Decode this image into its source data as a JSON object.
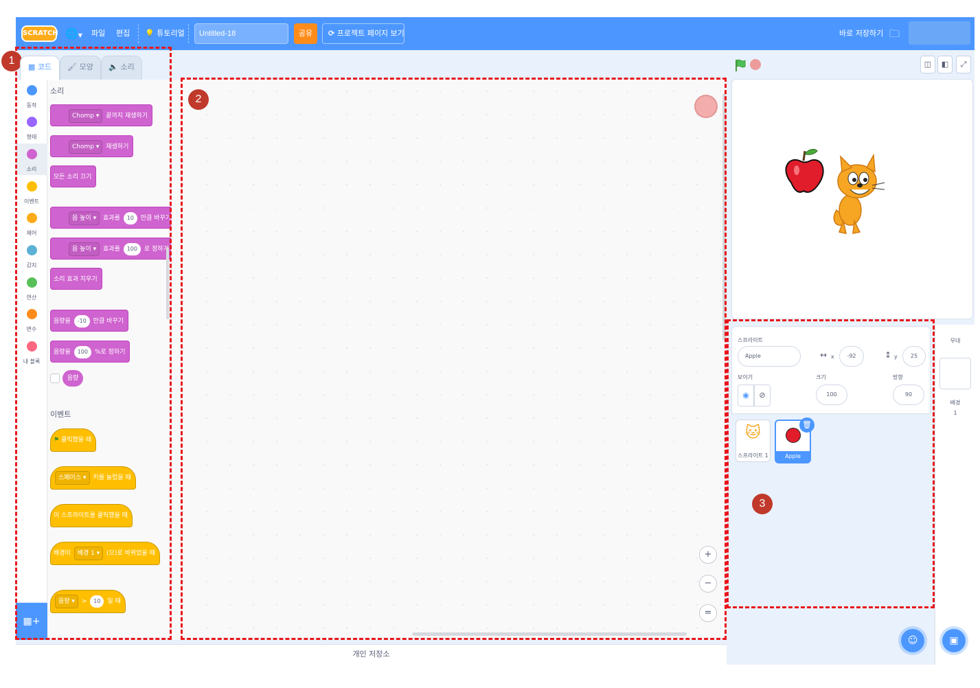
{
  "menubar": {
    "logo": "SCRATCH",
    "file": "파일",
    "edit": "편집",
    "tutorial": "튜토리얼",
    "project_title": "Untitled-18",
    "share": "공유",
    "see_project_page": "프로젝트 페이지 보기",
    "save_now": "바로 저장하기"
  },
  "tabs": {
    "code": "코드",
    "costumes": "모양",
    "sounds": "소리"
  },
  "categories": [
    {
      "label": "동작",
      "color": "#4c97ff"
    },
    {
      "label": "형태",
      "color": "#9966ff"
    },
    {
      "label": "소리",
      "color": "#cf63cf"
    },
    {
      "label": "이벤트",
      "color": "#ffbf00"
    },
    {
      "label": "제어",
      "color": "#ffab19"
    },
    {
      "label": "감지",
      "color": "#5cb1d6"
    },
    {
      "label": "연산",
      "color": "#59c059"
    },
    {
      "label": "변수",
      "color": "#ff8c1a"
    },
    {
      "label": "내 블록",
      "color": "#ff6680"
    }
  ],
  "palette": {
    "sound_heading": "소리",
    "play_until_done": {
      "sound": "Chomp",
      "text": "끝까지 재생하기"
    },
    "start_sound": {
      "sound": "Chomp",
      "text": "재생하기"
    },
    "stop_all_sounds": "모든 소리 끄기",
    "change_effect": {
      "effect": "음 높이",
      "pre": "효과를",
      "value": "10",
      "post": "만큼 바꾸기"
    },
    "set_effect": {
      "effect": "음 높이",
      "pre": "효과를",
      "value": "100",
      "post": "로 정하기"
    },
    "clear_effects": "소리 효과 지우기",
    "change_volume": {
      "pre": "음량을",
      "value": "-10",
      "post": "만큼 바꾸기"
    },
    "set_volume": {
      "pre": "음량을",
      "value": "100",
      "post": "%로 정하기"
    },
    "volume_reporter": "음량",
    "events_heading": "이벤트",
    "when_flag_clicked": "클릭했을 때",
    "when_key_pressed": {
      "key": "스페이스",
      "text": "키를 눌렀을 때"
    },
    "when_sprite_clicked": "이 스프라이트를 클릭했을 때",
    "when_backdrop_switches": {
      "pre": "배경이",
      "backdrop": "배경 1",
      "post": "(으)로 바뀌었을 때"
    },
    "when_greater_than": {
      "sensor": "음량",
      "op": ">",
      "value": "10",
      "post": "일 때"
    }
  },
  "workspace": {
    "zoom_in": "+",
    "zoom_out": "−",
    "zoom_reset": "="
  },
  "backpack_label": "개인 저장소",
  "sprite_info": {
    "sprite_label": "스프라이트",
    "sprite_name": "Apple",
    "x_label": "x",
    "x_value": "-92",
    "y_label": "y",
    "y_value": "25",
    "show_label": "보이기",
    "size_label": "크기",
    "size_value": "100",
    "direction_label": "방향",
    "direction_value": "90"
  },
  "sprites": [
    {
      "name": "스프라이트 1",
      "selected": false
    },
    {
      "name": "Apple",
      "selected": true
    }
  ],
  "stage_pane": {
    "title": "무대",
    "backdrops_label": "배경",
    "backdrops_count": "1"
  },
  "annotations": [
    "1",
    "2",
    "3"
  ],
  "colors": {
    "accent": "#4c97ff",
    "annotation_red": "#e8161b",
    "sound": "#cf63cf",
    "events": "#ffbf00"
  }
}
